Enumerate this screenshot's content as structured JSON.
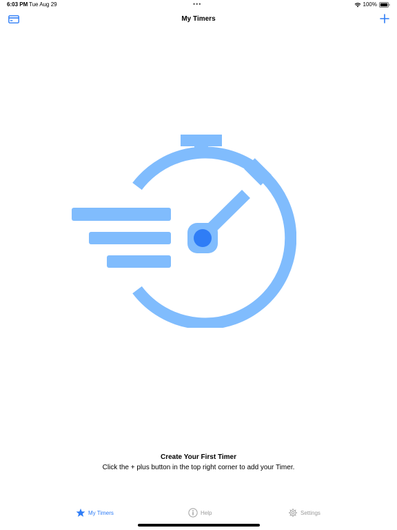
{
  "status_bar": {
    "time": "6:03 PM",
    "date": "Tue Aug 29",
    "dots": "•••",
    "battery": "100%"
  },
  "nav": {
    "title": "My Timers",
    "left_icon": "card-icon",
    "right_icon": "plus-icon"
  },
  "illustration_icon": "stopwatch-speed-icon",
  "empty_state": {
    "title": "Create Your First Timer",
    "subtitle": "Click the + plus button in the top right corner to add your Timer."
  },
  "tabs": [
    {
      "label": "My Timers",
      "icon": "star-icon",
      "active": true
    },
    {
      "label": "Help",
      "icon": "info-icon",
      "active": false
    },
    {
      "label": "Settings",
      "icon": "gear-icon",
      "active": false
    }
  ],
  "colors": {
    "accent": "#2F7DF6",
    "illustration": "#80BCFD",
    "inactive": "#9a9a9a"
  }
}
